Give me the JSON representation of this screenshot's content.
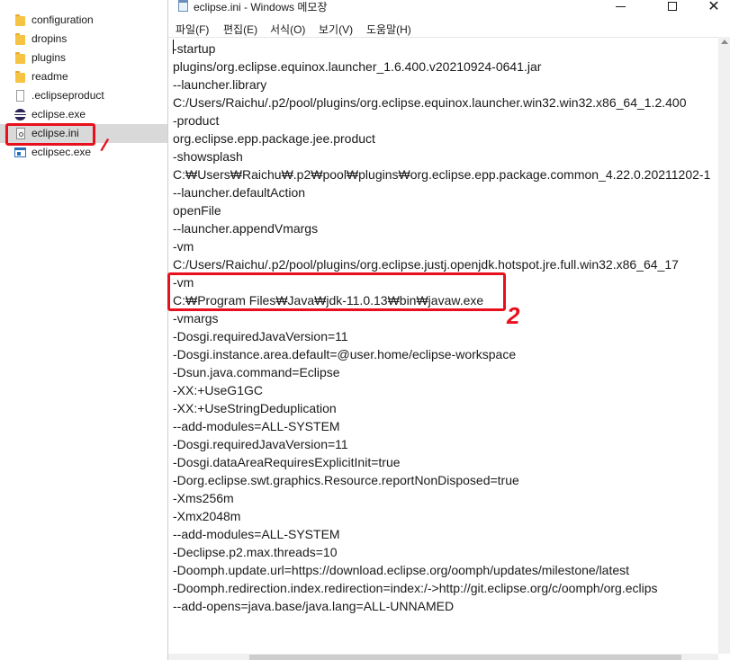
{
  "explorer": {
    "files": [
      {
        "name": "configuration",
        "icon": "folder-icon"
      },
      {
        "name": "dropins",
        "icon": "folder-icon"
      },
      {
        "name": "plugins",
        "icon": "folder-icon"
      },
      {
        "name": "readme",
        "icon": "folder-icon"
      },
      {
        "name": ".eclipseproduct",
        "icon": "file-icon"
      },
      {
        "name": "eclipse.exe",
        "icon": "eclipse-icon"
      },
      {
        "name": "eclipse.ini",
        "icon": "ini-file-icon",
        "selected": true
      },
      {
        "name": "eclipsec.exe",
        "icon": "exe-icon"
      }
    ]
  },
  "annotations": {
    "mark_1": "/",
    "mark_2": "2",
    "color": "#e8101c"
  },
  "notepad": {
    "title": "eclipse.ini - Windows 메모장",
    "menu": [
      "파일(F)",
      "편집(E)",
      "서식(O)",
      "보기(V)",
      "도움말(H)"
    ],
    "lines": [
      "-startup",
      "plugins/org.eclipse.equinox.launcher_1.6.400.v20210924-0641.jar",
      "--launcher.library",
      "C:/Users/Raichu/.p2/pool/plugins/org.eclipse.equinox.launcher.win32.win32.x86_64_1.2.400",
      "-product",
      "org.eclipse.epp.package.jee.product",
      "-showsplash",
      "C:₩Users₩Raichu₩.p2₩pool₩plugins₩org.eclipse.epp.package.common_4.22.0.20211202-1",
      "--launcher.defaultAction",
      "openFile",
      "--launcher.appendVmargs",
      "-vm",
      "C:/Users/Raichu/.p2/pool/plugins/org.eclipse.justj.openjdk.hotspot.jre.full.win32.x86_64_17",
      "-vm",
      "C:₩Program Files₩Java₩jdk-11.0.13₩bin₩javaw.exe",
      "-vmargs",
      "-Dosgi.requiredJavaVersion=11",
      "-Dosgi.instance.area.default=@user.home/eclipse-workspace",
      "-Dsun.java.command=Eclipse",
      "-XX:+UseG1GC",
      "-XX:+UseStringDeduplication",
      "--add-modules=ALL-SYSTEM",
      "-Dosgi.requiredJavaVersion=11",
      "-Dosgi.dataAreaRequiresExplicitInit=true",
      "-Dorg.eclipse.swt.graphics.Resource.reportNonDisposed=true",
      "-Xms256m",
      "-Xmx2048m",
      "--add-modules=ALL-SYSTEM",
      "-Declipse.p2.max.threads=10",
      "-Doomph.update.url=https://download.eclipse.org/oomph/updates/milestone/latest",
      "-Doomph.redirection.index.redirection=index:/->http://git.eclipse.org/c/oomph/org.eclips",
      "--add-opens=java.base/java.lang=ALL-UNNAMED"
    ]
  }
}
